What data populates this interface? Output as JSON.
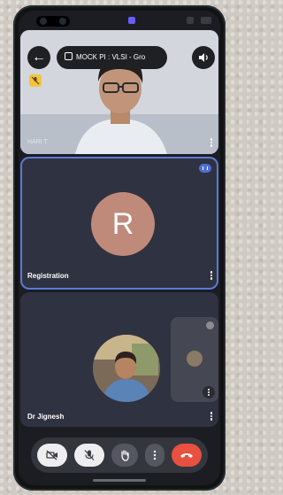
{
  "meeting": {
    "title": "MOCK PI : VLSI - Gro"
  },
  "participants": {
    "hari": {
      "name": "HARI T"
    },
    "registration": {
      "initial": "R",
      "name": "Registration",
      "avatar_color": "#c08a7a"
    },
    "jignesh": {
      "name": "Dr Jignesh"
    }
  },
  "icons": {
    "back": "arrow-left-icon",
    "calendar": "calendar-icon",
    "speaker": "speaker-icon",
    "muted": "mic-muted-icon",
    "speaking": "speaking-indicator-icon",
    "camera_off": "camera-off-icon",
    "mic_off": "mic-off-icon",
    "raise_hand": "hand-icon",
    "more": "more-vert-icon",
    "hangup": "hangup-icon"
  },
  "colors": {
    "active_speaker_border": "#5d79d6",
    "hangup": "#e8503f",
    "muted_badge": "#f3c43b"
  }
}
